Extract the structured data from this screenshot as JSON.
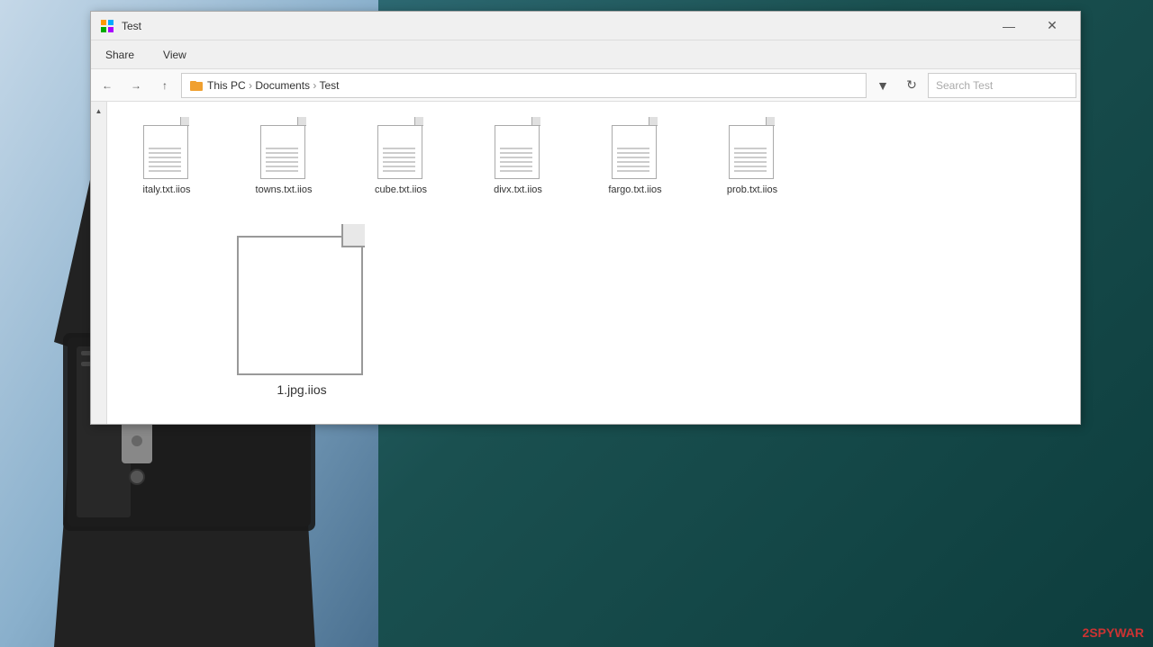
{
  "window": {
    "title": "Test",
    "minimize_label": "—",
    "close_label": "✕"
  },
  "ribbon": {
    "tabs": [
      "Share",
      "View"
    ]
  },
  "addressbar": {
    "path_parts": [
      "This PC",
      "Documents",
      "Test"
    ],
    "search_placeholder": "Search Test"
  },
  "files_row1": [
    {
      "name": "italy.txt.iios"
    },
    {
      "name": "towns.txt.iios"
    },
    {
      "name": "cube.txt.iios"
    },
    {
      "name": "divx.txt.iios"
    },
    {
      "name": "fargo.txt.iios"
    },
    {
      "name": "prob.txt.iios"
    }
  ],
  "file_large": {
    "name": "1.jpg.iios"
  },
  "watermark": "2SPYWAR"
}
